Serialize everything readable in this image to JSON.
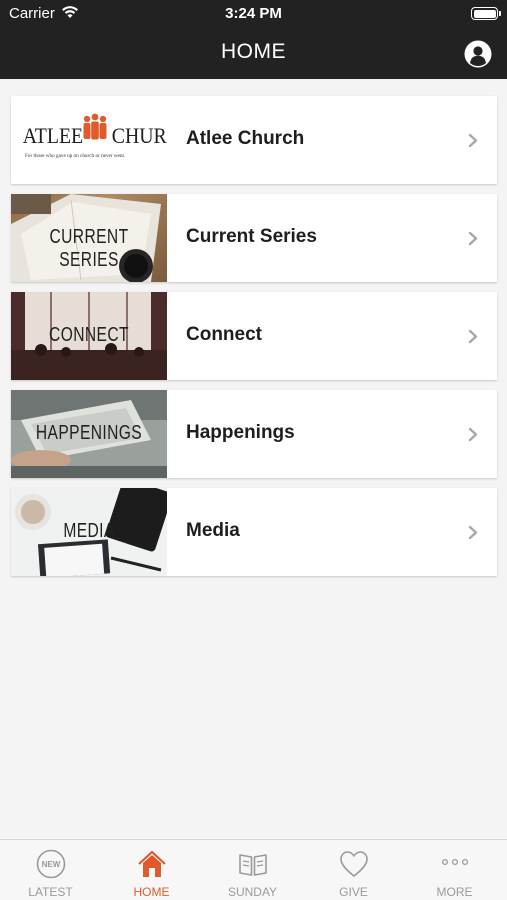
{
  "status_bar": {
    "carrier": "Carrier",
    "time": "3:24 PM"
  },
  "nav": {
    "title": "HOME"
  },
  "list": [
    {
      "label": "Atlee Church",
      "thumb_text": ""
    },
    {
      "label": "Current Series",
      "thumb_text": "CURRENT SERIES"
    },
    {
      "label": "Connect",
      "thumb_text": "CONNECT"
    },
    {
      "label": "Happenings",
      "thumb_text": "HAPPENINGS"
    },
    {
      "label": "Media",
      "thumb_text": "MEDIA"
    }
  ],
  "logo": {
    "left": "ATLEE",
    "right": "CHURCH",
    "tagline": "For those who gave up on church or never went.",
    "accent": "#e05a2b"
  },
  "tabs": [
    {
      "label": "LATEST",
      "icon": "new-badge-icon",
      "badge": "NEW"
    },
    {
      "label": "HOME",
      "icon": "home-icon"
    },
    {
      "label": "SUNDAY",
      "icon": "book-icon"
    },
    {
      "label": "GIVE",
      "icon": "heart-icon"
    },
    {
      "label": "MORE",
      "icon": "more-dots-icon"
    }
  ],
  "colors": {
    "header": "#222222",
    "accent": "#e05a2b",
    "inactive": "#9a9a9a"
  }
}
